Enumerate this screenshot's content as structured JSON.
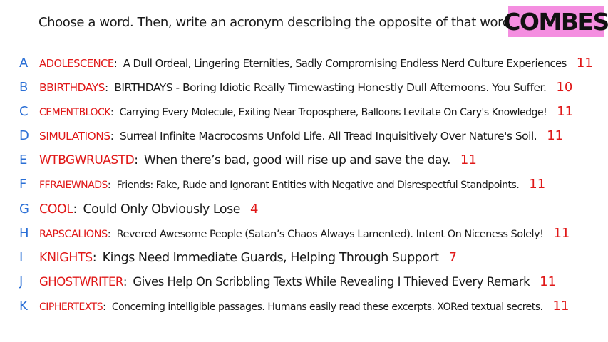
{
  "header": {
    "prompt": "Choose a word. Then, write an acronym describing the opposite of that word!",
    "badge": "COMBES"
  },
  "colors": {
    "letter": "#2a6fd6",
    "word": "#e01818",
    "count": "#e01818",
    "badge_bg": "#f48ee0"
  },
  "rows": [
    {
      "letter": "A",
      "word": "ADOLESCENCE",
      "phrase": "A Dull Ordeal, Lingering Eternities, Sadly Compromising Endless Nerd Culture Experiences",
      "count": "11"
    },
    {
      "letter": "B",
      "word": "BBIRTHDAYS",
      "phrase": "BIRTHDAYS - Boring Idiotic Really Timewasting Honestly Dull Afternoons. You Suffer.",
      "count": "10"
    },
    {
      "letter": "C",
      "word": "CEMENTBLOCK",
      "phrase": "Carrying Every Molecule, Exiting Near Troposphere, Balloons Levitate On Cary's Knowledge!",
      "count": "11"
    },
    {
      "letter": "D",
      "word": "SIMULATIONS",
      "phrase": "Surreal Infinite Macrocosms Unfold Life. All Tread Inquisitively Over Nature's Soil.",
      "count": "11"
    },
    {
      "letter": "E",
      "word": "WTBGWRUASTD",
      "phrase": "When there’s bad, good will rise up and save the day.",
      "count": "11"
    },
    {
      "letter": "F",
      "word": "FFRAIEWNADS",
      "phrase": "Friends: Fake, Rude and Ignorant Entities with Negative and Disrespectful Standpoints.",
      "count": "11"
    },
    {
      "letter": "G",
      "word": "COOL",
      "phrase": "Could Only Obviously Lose",
      "count": "4"
    },
    {
      "letter": "H",
      "word": "RAPSCALIONS",
      "phrase": "Revered Awesome People (Satan’s Chaos Always Lamented). Intent On Niceness Solely!",
      "count": "11"
    },
    {
      "letter": "I",
      "word": "KNIGHTS",
      "phrase": "Kings Need Immediate Guards, Helping Through Support",
      "count": "7"
    },
    {
      "letter": "J",
      "word": "GHOSTWRITER",
      "phrase": "Gives Help On Scribbling Texts While Revealing I Thieved Every Remark",
      "count": "11"
    },
    {
      "letter": "K",
      "word": "CIPHERTEXTS",
      "phrase": "Concerning intelligible passages. Humans easily read these excerpts. XORed textual secrets.",
      "count": "11"
    }
  ]
}
